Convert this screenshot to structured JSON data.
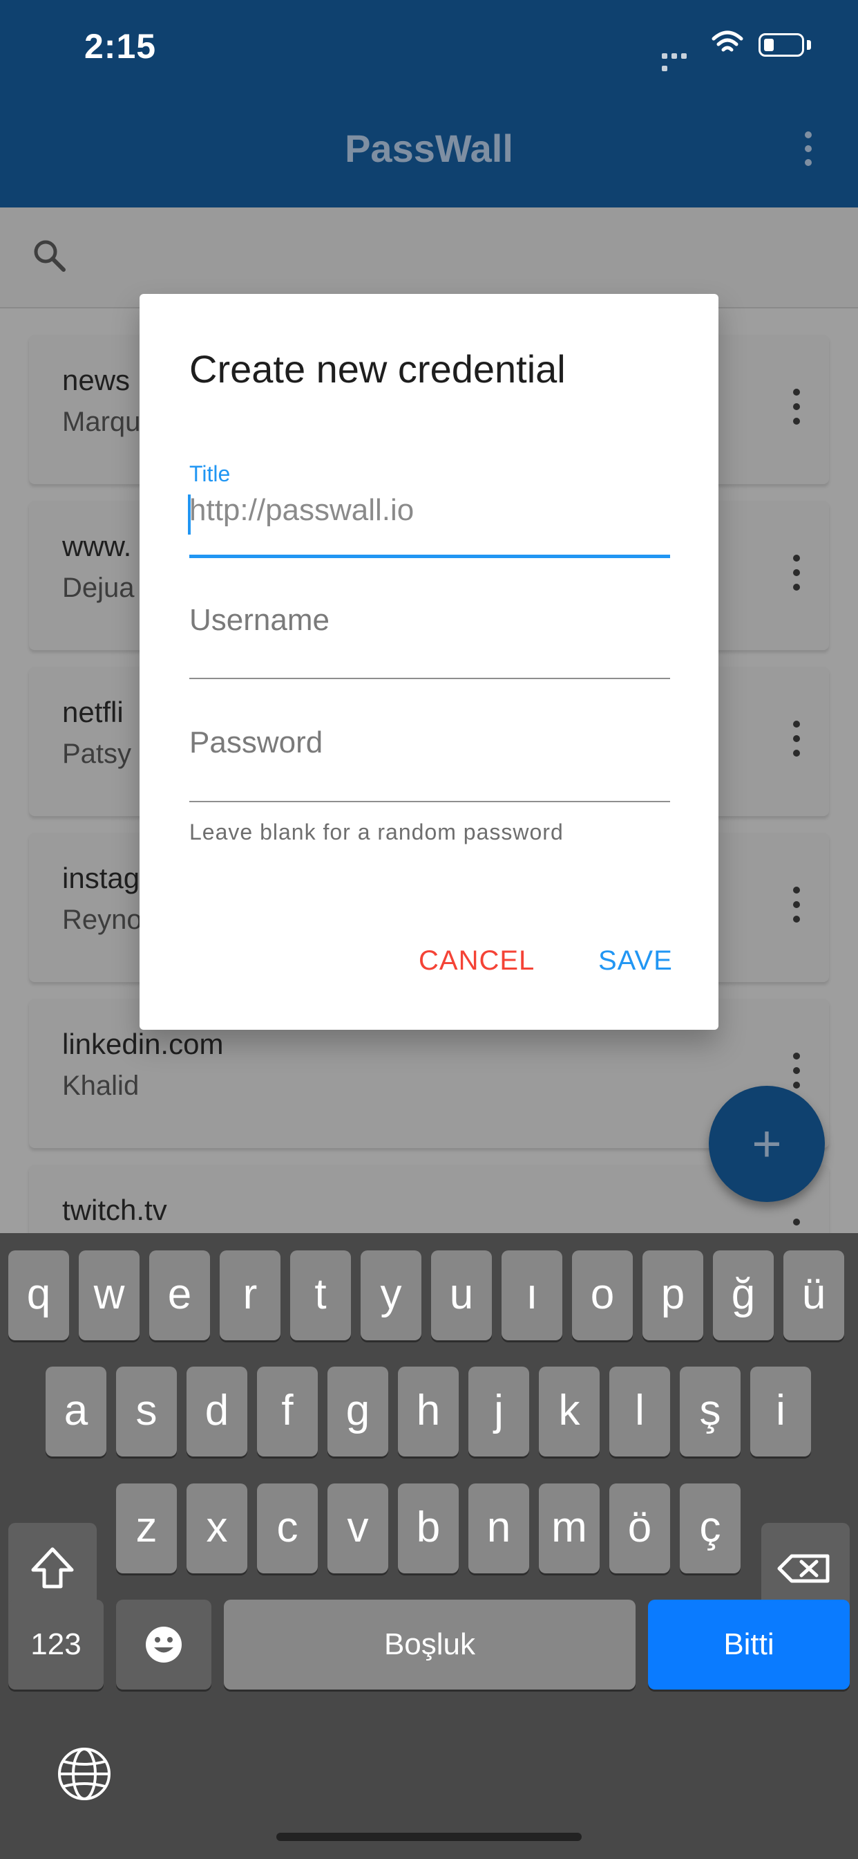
{
  "status_bar": {
    "time": "2:15"
  },
  "app_bar": {
    "title": "PassWall"
  },
  "list": {
    "items": [
      {
        "title": "news",
        "subtitle": "Marqu"
      },
      {
        "title": "www.",
        "subtitle": "Dejua"
      },
      {
        "title": "netfli",
        "subtitle": "Patsy"
      },
      {
        "title": "instag",
        "subtitle": "Reyno"
      },
      {
        "title": "linkedin.com",
        "subtitle": "Khalid"
      },
      {
        "title": "twitch.tv",
        "subtitle": ""
      }
    ]
  },
  "fab": {
    "label": "+"
  },
  "dialog": {
    "title": "Create new credential",
    "title_field": {
      "label": "Title",
      "placeholder": "http://passwall.io"
    },
    "username_field": {
      "placeholder": "Username"
    },
    "password_field": {
      "placeholder": "Password"
    },
    "helper_text": "Leave blank for a random password",
    "cancel_label": "CANCEL",
    "save_label": "SAVE"
  },
  "keyboard": {
    "row1": [
      "q",
      "w",
      "e",
      "r",
      "t",
      "y",
      "u",
      "ı",
      "o",
      "p",
      "ğ",
      "ü"
    ],
    "row2": [
      "a",
      "s",
      "d",
      "f",
      "g",
      "h",
      "j",
      "k",
      "l",
      "ş",
      "i"
    ],
    "row3": [
      "z",
      "x",
      "c",
      "v",
      "b",
      "n",
      "m",
      "ö",
      "ç"
    ],
    "numbers_label": "123",
    "space_label": "Boşluk",
    "done_label": "Bitti",
    "accent_color": "#0a7bff"
  }
}
